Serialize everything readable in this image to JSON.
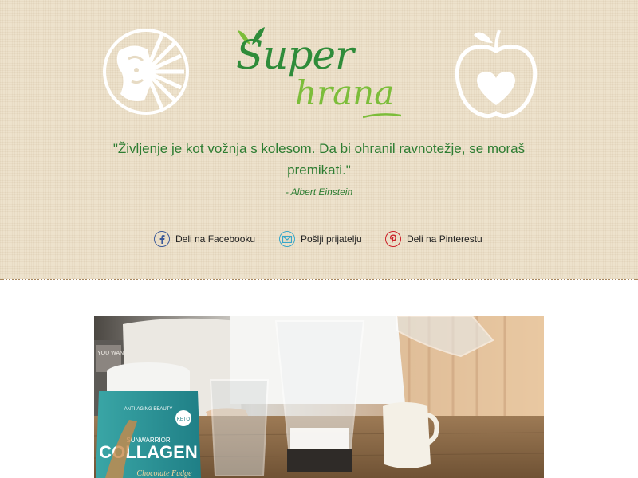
{
  "brand": {
    "line1": "Super",
    "line2": "hrana"
  },
  "quote": {
    "text": "\"Življenje je kot vožnja s kolesom. Da bi ohranil ravnotežje, se moraš premikati.\"",
    "author": "- Albert Einstein"
  },
  "share": {
    "facebook": "Deli na Facebooku",
    "email": "Pošlji prijatelju",
    "pinterest": "Deli na Pinterestu"
  },
  "photo": {
    "product_brand": "SUNWARRIOR",
    "product_name": "COLLAGEN",
    "product_tag": "ANTI-AGING BEAUTY",
    "product_badge": "KETO",
    "product_flavor": "Chocolate Fudge",
    "pillow_text": "YOU WANT BEST"
  },
  "colors": {
    "header_bg": "#ede2cc",
    "brand_green": "#2f8c3a",
    "brand_lime": "#7cbd3a",
    "quote_green": "#2e7d32",
    "facebook": "#3b5998",
    "email": "#37a7c9",
    "pinterest": "#cb2027"
  },
  "icons": [
    "sun-face-logo-icon",
    "apple-heart-logo-icon",
    "facebook-icon",
    "envelope-icon",
    "pinterest-icon"
  ]
}
